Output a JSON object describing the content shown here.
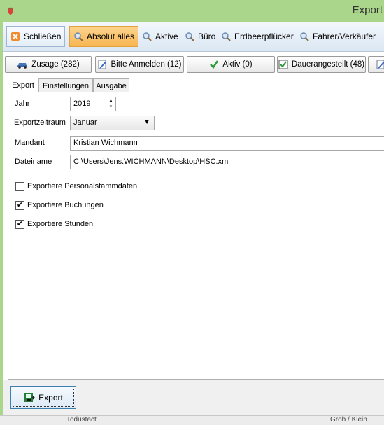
{
  "window": {
    "title": "Export"
  },
  "toolbar": {
    "close_label": "Schließen",
    "items": [
      {
        "label": "Absolut alles"
      },
      {
        "label": "Aktive"
      },
      {
        "label": "Büro"
      },
      {
        "label": "Erdbeerpflücker"
      },
      {
        "label": "Fahrer/Verkäufer"
      }
    ]
  },
  "filters": [
    {
      "label": "Zusage (282)",
      "icon": "car-icon"
    },
    {
      "label": "Bitte Anmelden (12)",
      "icon": "pencil-icon"
    },
    {
      "label": "Aktiv (0)",
      "icon": "checkmark-icon"
    },
    {
      "label": "Dauerangestellt (48)",
      "icon": "checkbox-icon"
    }
  ],
  "tabs": [
    {
      "label": "Export"
    },
    {
      "label": "Einstellungen"
    },
    {
      "label": "Ausgabe"
    }
  ],
  "form": {
    "year_label": "Jahr",
    "year_value": "2019",
    "period_label": "Exportzeitraum",
    "period_value": "Januar",
    "client_label": "Mandant",
    "client_value": "Kristian Wichmann",
    "file_label": "Dateiname",
    "file_value": "C:\\Users\\Jens.WICHMANN\\Desktop\\HSC.xml"
  },
  "checkboxes": [
    {
      "label": "Exportiere Personalstammdaten",
      "checked": false
    },
    {
      "label": "Exportiere Buchungen",
      "checked": true
    },
    {
      "label": "Exportiere Stunden",
      "checked": true
    }
  ],
  "footer": {
    "export_label": "Export"
  },
  "background": {
    "left_text": "Todustact",
    "right_text": "Grob / Klein"
  },
  "colors": {
    "titlebar": "#a9d68a",
    "active_toolbar": "#f7b553",
    "accent": "#3c7fb1"
  }
}
